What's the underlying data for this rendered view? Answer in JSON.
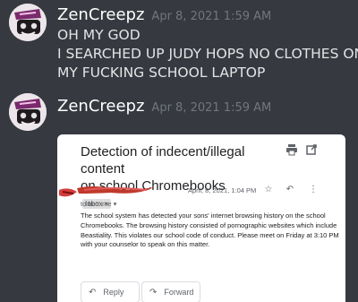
{
  "messages": [
    {
      "author": "ZenCreepz",
      "timestamp": "Apr 8, 2021 1:59 AM",
      "lines": [
        "OH MY GOD",
        "I SEARCHED UP JUDY HOPS NO CLOTHES ON",
        "MY FUCKING SCHOOL LAPTOP"
      ]
    },
    {
      "author": "ZenCreepz",
      "timestamp": "Apr 8, 2021 1:59 AM"
    }
  ],
  "email": {
    "subject_line1": "Detection of indecent/illegal content",
    "subject_line2": "on school Chromebooks",
    "label": "Inbox ×",
    "date": "April, 8, 2021, 1:04 PM",
    "to": "to bcc: me ▾",
    "body": "The school system has detected your sons' internet browsing history on the school Chromebooks. The browsing history consisted of pornographic websites which include Beastiality. This violates our school code of conduct. Please meet on Friday at 3:10 PM with your counselor to speak on this matter.",
    "reply_label": "Reply",
    "forward_label": "Forward",
    "icons": [
      "print-icon",
      "open-new-window-icon",
      "star-icon",
      "reply-icon",
      "more-vert-icon"
    ]
  },
  "colors": {
    "background": "#36393f",
    "username": "#ffffff",
    "timestamp": "#72767d",
    "message_text": "#e3e4e6",
    "redaction": "#c0392b"
  }
}
